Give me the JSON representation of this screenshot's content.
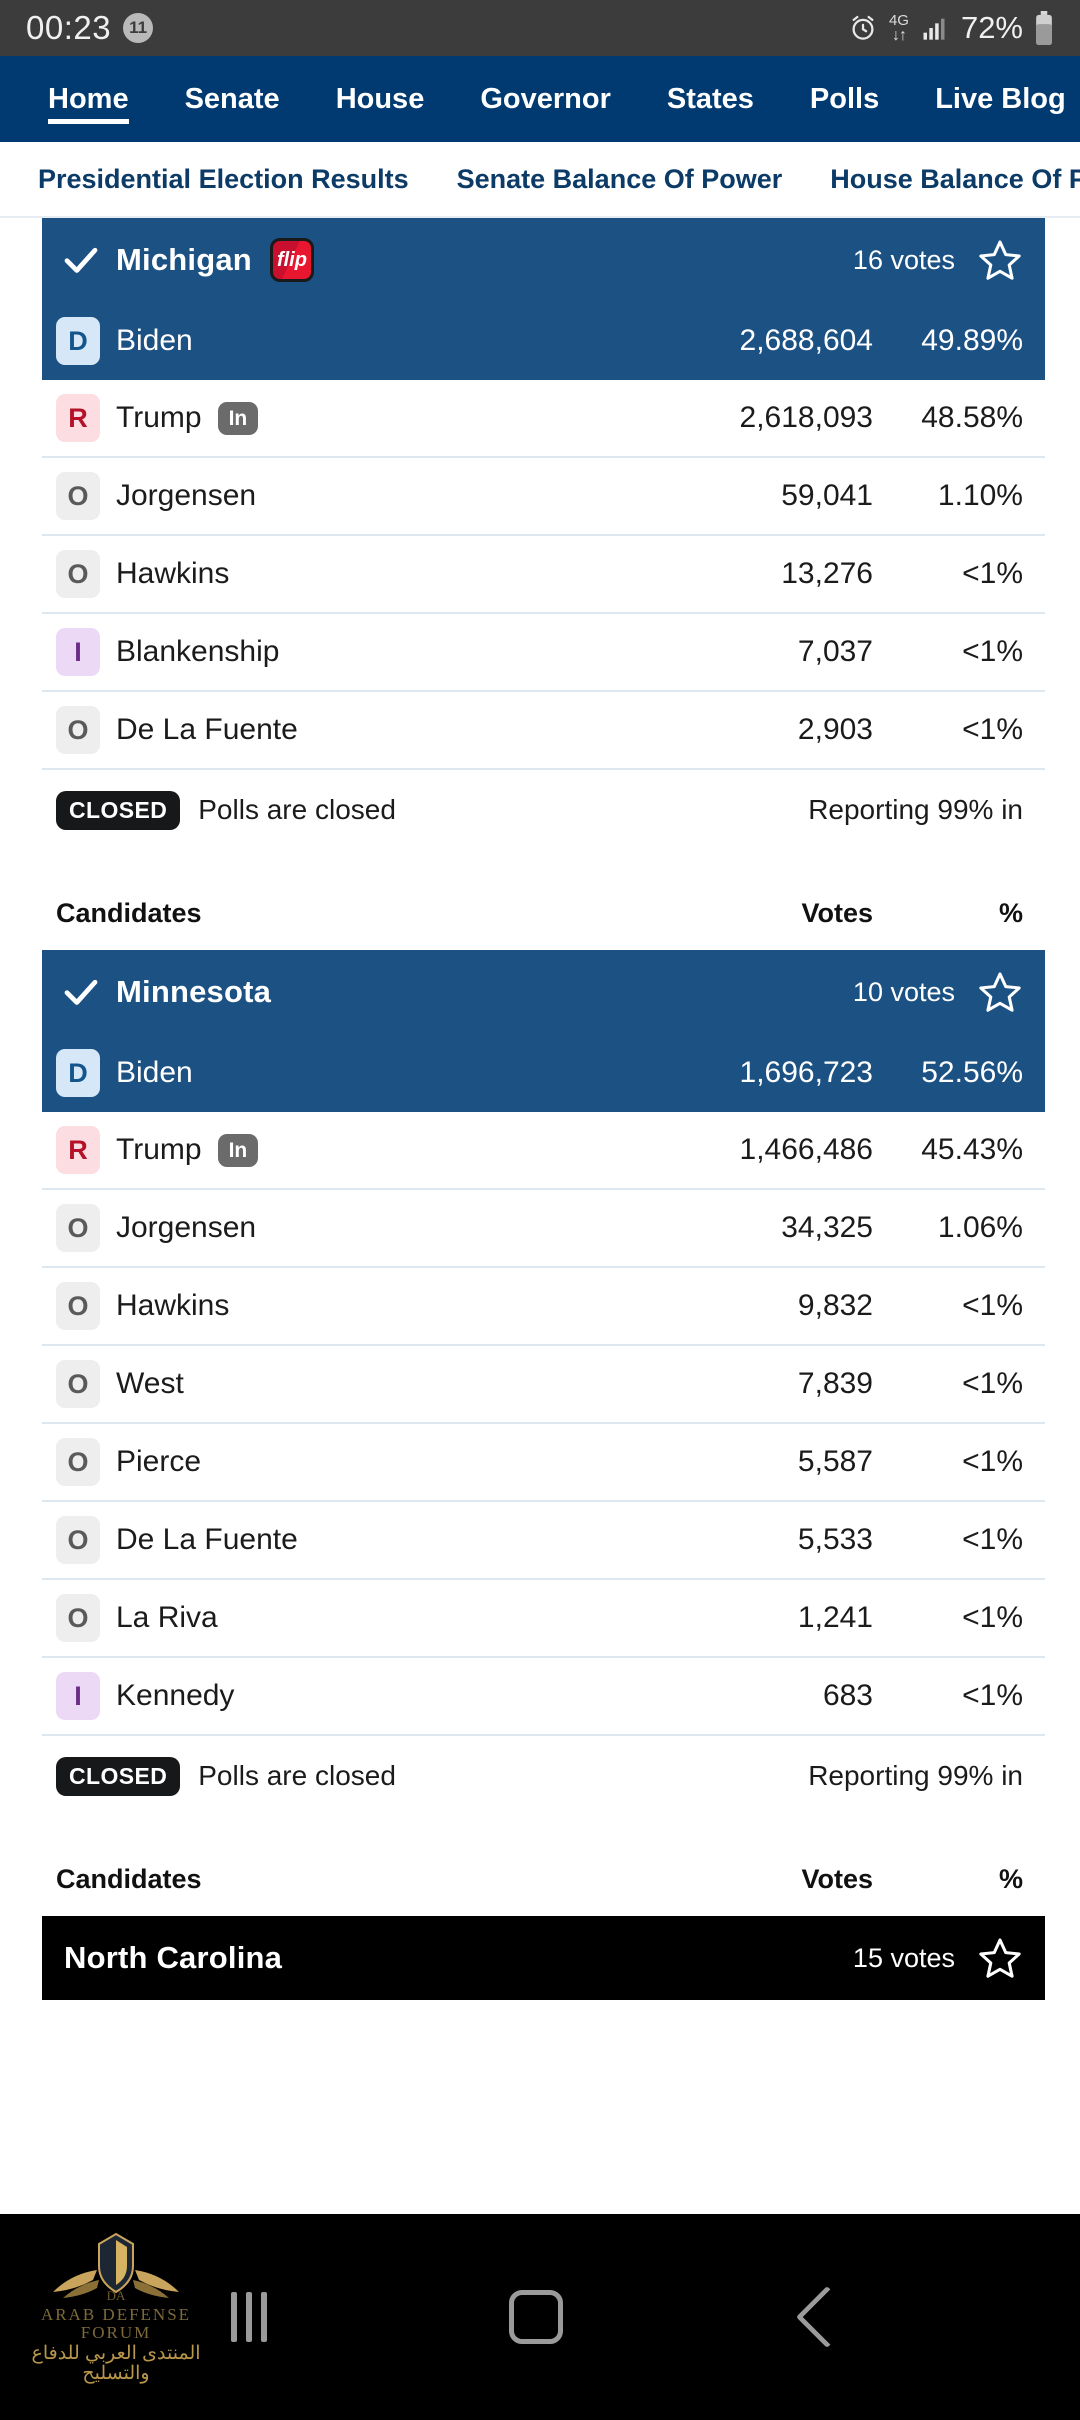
{
  "status_bar": {
    "time": "00:23",
    "notification_count": "11",
    "network_type": "4G",
    "battery_percent": "72%",
    "icons": [
      "alarm-icon",
      "data-transfer-icon",
      "signal-bars-icon",
      "battery-icon"
    ]
  },
  "top_nav": {
    "items": [
      {
        "label": "Home",
        "active": true
      },
      {
        "label": "Senate",
        "active": false
      },
      {
        "label": "House",
        "active": false
      },
      {
        "label": "Governor",
        "active": false
      },
      {
        "label": "States",
        "active": false
      },
      {
        "label": "Polls",
        "active": false
      },
      {
        "label": "Live Blog",
        "active": false
      }
    ]
  },
  "sub_nav": {
    "items": [
      {
        "label": "Presidential Election Results"
      },
      {
        "label": "Senate Balance Of Power"
      },
      {
        "label": "House Balance Of Power"
      }
    ]
  },
  "table_headers": {
    "candidates": "Candidates",
    "votes": "Votes",
    "percent": "%"
  },
  "states": [
    {
      "name": "Michigan",
      "called": true,
      "flip": "flip",
      "electoral_votes": "16 votes",
      "header_style": "blue",
      "candidates": [
        {
          "party": "D",
          "name": "Biden",
          "incumbent": "",
          "votes": "2,688,604",
          "pct": "49.89%",
          "leading": true
        },
        {
          "party": "R",
          "name": "Trump",
          "incumbent": "In",
          "votes": "2,618,093",
          "pct": "48.58%",
          "leading": false
        },
        {
          "party": "O",
          "name": "Jorgensen",
          "incumbent": "",
          "votes": "59,041",
          "pct": "1.10%",
          "leading": false
        },
        {
          "party": "O",
          "name": "Hawkins",
          "incumbent": "",
          "votes": "13,276",
          "pct": "<1%",
          "leading": false
        },
        {
          "party": "I",
          "name": "Blankenship",
          "incumbent": "",
          "votes": "7,037",
          "pct": "<1%",
          "leading": false
        },
        {
          "party": "O",
          "name": "De La Fuente",
          "incumbent": "",
          "votes": "2,903",
          "pct": "<1%",
          "leading": false
        }
      ],
      "poll_status_badge": "CLOSED",
      "poll_status_text": "Polls are closed",
      "reporting": "Reporting 99% in"
    },
    {
      "name": "Minnesota",
      "called": true,
      "flip": "",
      "electoral_votes": "10 votes",
      "header_style": "blue",
      "candidates": [
        {
          "party": "D",
          "name": "Biden",
          "incumbent": "",
          "votes": "1,696,723",
          "pct": "52.56%",
          "leading": true
        },
        {
          "party": "R",
          "name": "Trump",
          "incumbent": "In",
          "votes": "1,466,486",
          "pct": "45.43%",
          "leading": false
        },
        {
          "party": "O",
          "name": "Jorgensen",
          "incumbent": "",
          "votes": "34,325",
          "pct": "1.06%",
          "leading": false
        },
        {
          "party": "O",
          "name": "Hawkins",
          "incumbent": "",
          "votes": "9,832",
          "pct": "<1%",
          "leading": false
        },
        {
          "party": "O",
          "name": "West",
          "incumbent": "",
          "votes": "7,839",
          "pct": "<1%",
          "leading": false
        },
        {
          "party": "O",
          "name": "Pierce",
          "incumbent": "",
          "votes": "5,587",
          "pct": "<1%",
          "leading": false
        },
        {
          "party": "O",
          "name": "De La Fuente",
          "incumbent": "",
          "votes": "5,533",
          "pct": "<1%",
          "leading": false
        },
        {
          "party": "O",
          "name": "La Riva",
          "incumbent": "",
          "votes": "1,241",
          "pct": "<1%",
          "leading": false
        },
        {
          "party": "I",
          "name": "Kennedy",
          "incumbent": "",
          "votes": "683",
          "pct": "<1%",
          "leading": false
        }
      ],
      "poll_status_badge": "CLOSED",
      "poll_status_text": "Polls are closed",
      "reporting": "Reporting 99% in"
    },
    {
      "name": "North Carolina",
      "called": false,
      "flip": "",
      "electoral_votes": "15 votes",
      "header_style": "black",
      "candidates": [],
      "poll_status_badge": "",
      "poll_status_text": "",
      "reporting": ""
    }
  ],
  "watermark": {
    "english": "ARAB DEFENSE FORUM",
    "arabic": "المنتدى العربي للدفاع والتسليح"
  },
  "nav_bar": {
    "recents_label": "recents-button",
    "home_label": "home-button",
    "back_label": "back-button"
  },
  "colors": {
    "brand_blue": "#003a70",
    "row_highlight": "#1c5183",
    "democrat": "#14558c",
    "republican": "#b51229",
    "independent": "#6b2d86",
    "other": "#5a5a5a"
  }
}
